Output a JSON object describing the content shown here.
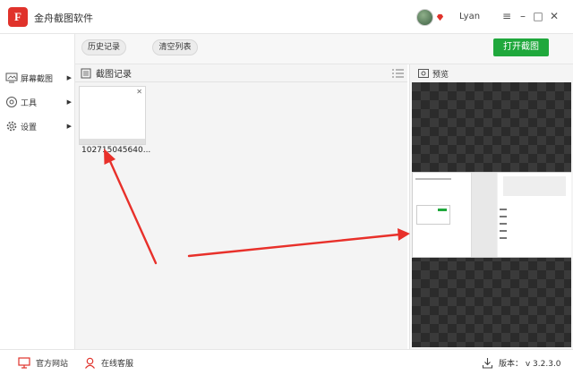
{
  "app": {
    "title": "金舟截图软件",
    "username": "Lyan"
  },
  "window_controls": {
    "minimize": "–",
    "maximize": "□",
    "close": "✕",
    "menu": "≡"
  },
  "sidebar": {
    "items": [
      {
        "label": "屏幕截图",
        "icon": "screen-icon"
      },
      {
        "label": "工具",
        "icon": "tools-icon"
      },
      {
        "label": "设置",
        "icon": "gear-icon"
      }
    ]
  },
  "toolbar": {
    "history_label": "历史记录",
    "clear_label": "清空列表",
    "open_label": "打开截图"
  },
  "records": {
    "title": "截图记录",
    "items": [
      {
        "name": "102715045640..."
      }
    ]
  },
  "preview": {
    "title": "预览"
  },
  "footer": {
    "website": "官方网站",
    "support": "在线客服",
    "version": "版本： v 3.2.3.0"
  },
  "colors": {
    "accent_green": "#1fa83c",
    "brand_red": "#e0322b",
    "annotation_red": "#e8302a"
  }
}
